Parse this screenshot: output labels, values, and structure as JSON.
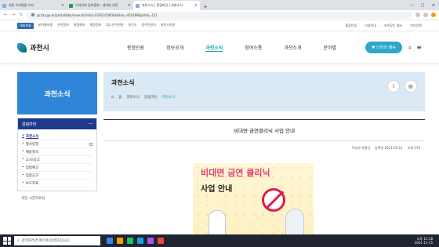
{
  "browser": {
    "tabs": [
      {
        "label": "쉬운 우리말을 쓰자",
        "active": false
      },
      {
        "label": "디자인의 검색결과 : 네이버 사전",
        "active": false
      },
      {
        "label": "과천소식 | 알림마당 | 과천소식",
        "active": true
      }
    ],
    "url": "gccity.go.kr/portal/bbs/view.do?mId=0301010000&bIdx=450198&ptIdx=111"
  },
  "top_sites": [
    "대표포털",
    "분야별포털",
    "주민참여",
    "통합예약",
    "행정정보",
    "청소년수련관",
    "보건소",
    "동주민센터",
    "과천시자원"
  ],
  "top_utils": [
    "통합인증",
    "이용안내",
    "자주찾는 메뉴",
    "언어선택"
  ],
  "logo_text": "과천시",
  "menus": [
    "종합민원",
    "정보공개",
    "과천소식",
    "참여소통",
    "과천소개",
    "분야별"
  ],
  "active_menu": "과천소식",
  "my_menu": "나만의 메뉴",
  "sidebar": {
    "title": "과천소식",
    "section": "알림마당",
    "items": [
      "과천소식",
      "행사일정",
      "채용정보",
      "고시/공고",
      "입법예고",
      "입찰공고",
      "보도자료"
    ],
    "footer": "과천 시진자료실"
  },
  "content": {
    "page_title": "과천소식",
    "breadcrumb": [
      "홈",
      "과천소식",
      "알림마당",
      "과천소식"
    ],
    "article_title": "비대면 금연클리닉 사업 안내",
    "author": "작성자 박병선",
    "date": "등록일 2021-03-11",
    "views": "조회 576",
    "poster_line1": "비대면 금연 클리닉",
    "poster_line2": "사업 안내"
  },
  "taskbar": {
    "search_placeholder": "검색하려면 여기에 입력하십시오.",
    "time": "오후 11:18",
    "date": "2021-11-15"
  },
  "colors": {
    "accent": "#2f86d8",
    "active": "#1aa0a0",
    "sidebar_sub": "#1f3a8a"
  }
}
